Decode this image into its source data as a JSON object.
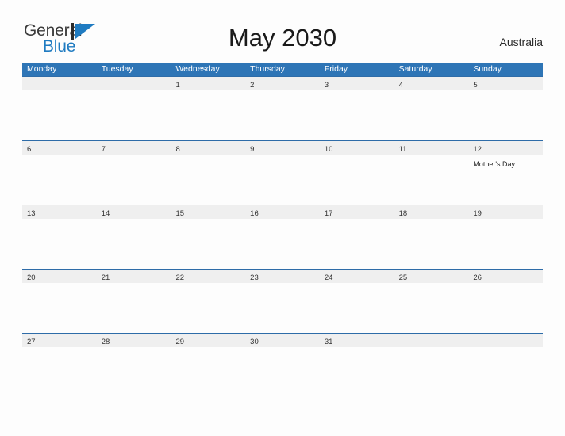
{
  "brand": {
    "name_part1": "General",
    "name_part2": "Blue",
    "mark_icon": "blue-triangle-flag-icon",
    "color_primary": "#1f7bc1",
    "color_text": "#3b3b3b"
  },
  "header": {
    "title": "May 2030",
    "region": "Australia"
  },
  "colors": {
    "header_bar": "#2e75b6",
    "row_band": "#efefef",
    "row_rule": "#2e6ca8",
    "page_background": "#fdfdfd"
  },
  "calendar": {
    "month": "May",
    "year": "2030",
    "weekday_headers": [
      "Monday",
      "Tuesday",
      "Wednesday",
      "Thursday",
      "Friday",
      "Saturday",
      "Sunday"
    ],
    "weeks": [
      {
        "days": [
          {
            "number": "",
            "event": ""
          },
          {
            "number": "",
            "event": ""
          },
          {
            "number": "1",
            "event": ""
          },
          {
            "number": "2",
            "event": ""
          },
          {
            "number": "3",
            "event": ""
          },
          {
            "number": "4",
            "event": ""
          },
          {
            "number": "5",
            "event": ""
          }
        ]
      },
      {
        "days": [
          {
            "number": "6",
            "event": ""
          },
          {
            "number": "7",
            "event": ""
          },
          {
            "number": "8",
            "event": ""
          },
          {
            "number": "9",
            "event": ""
          },
          {
            "number": "10",
            "event": ""
          },
          {
            "number": "11",
            "event": ""
          },
          {
            "number": "12",
            "event": "Mother's Day"
          }
        ]
      },
      {
        "days": [
          {
            "number": "13",
            "event": ""
          },
          {
            "number": "14",
            "event": ""
          },
          {
            "number": "15",
            "event": ""
          },
          {
            "number": "16",
            "event": ""
          },
          {
            "number": "17",
            "event": ""
          },
          {
            "number": "18",
            "event": ""
          },
          {
            "number": "19",
            "event": ""
          }
        ]
      },
      {
        "days": [
          {
            "number": "20",
            "event": ""
          },
          {
            "number": "21",
            "event": ""
          },
          {
            "number": "22",
            "event": ""
          },
          {
            "number": "23",
            "event": ""
          },
          {
            "number": "24",
            "event": ""
          },
          {
            "number": "25",
            "event": ""
          },
          {
            "number": "26",
            "event": ""
          }
        ]
      },
      {
        "days": [
          {
            "number": "27",
            "event": ""
          },
          {
            "number": "28",
            "event": ""
          },
          {
            "number": "29",
            "event": ""
          },
          {
            "number": "30",
            "event": ""
          },
          {
            "number": "31",
            "event": ""
          },
          {
            "number": "",
            "event": ""
          },
          {
            "number": "",
            "event": ""
          }
        ]
      }
    ]
  }
}
